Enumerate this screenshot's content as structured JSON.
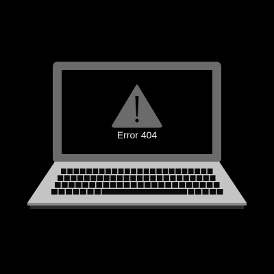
{
  "screen": {
    "message": "Error 404",
    "icon": "warning-triangle-icon"
  },
  "colors": {
    "background": "#000000",
    "lid": "#6b6b6b",
    "deck": "#c4c4c4",
    "deck_edge": "#8a8a8a",
    "keys": "#0a0a0a"
  }
}
